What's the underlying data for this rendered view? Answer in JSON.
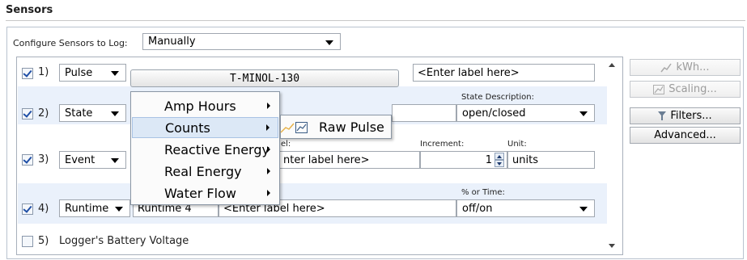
{
  "section_title": "Sensors",
  "configure": {
    "label": "Configure Sensors to Log:",
    "value": "Manually"
  },
  "rows": [
    {
      "num": "1)",
      "type": "Pulse",
      "checked": true,
      "device_button": "T-MINOL-130",
      "label_field": "<Enter label here>"
    },
    {
      "num": "2)",
      "type": "State",
      "checked": true,
      "state_desc_header": "State Description:",
      "state_desc_value": "open/closed"
    },
    {
      "num": "3)",
      "type": "Event",
      "checked": true,
      "label_header": "el:",
      "label_field": "nter label here>",
      "increment_header": "Increment:",
      "increment_value": "1",
      "unit_header": "Unit:",
      "unit_value": "units"
    },
    {
      "num": "4)",
      "type": "Runtime",
      "checked": true,
      "name_value": "Runtime 4",
      "label_field": "<Enter label here>",
      "percent_header": "% or Time:",
      "percent_value": "off/on"
    },
    {
      "num": "5)",
      "label": "Logger's Battery Voltage",
      "checked": false
    }
  ],
  "side_buttons": {
    "kwh": "kWh...",
    "scaling": "Scaling...",
    "filters": "Filters...",
    "advanced": "Advanced..."
  },
  "context_menu": {
    "items": [
      "Amp Hours",
      "Counts",
      "Reactive Energy",
      "Real Energy",
      "Water Flow"
    ],
    "highlighted": "Counts"
  },
  "submenu": {
    "items": [
      "Raw Pulse"
    ]
  },
  "icons": {
    "kwh": "line-chart-icon",
    "scaling": "scaling-chart-icon",
    "filters": "funnel-filter-icon",
    "raw_pulse": "pulse-chart-icon"
  },
  "colors": {
    "row_alt": "#eaf1fb",
    "menu_highlight": "#dce8f6",
    "check": "#1f4fa6"
  }
}
